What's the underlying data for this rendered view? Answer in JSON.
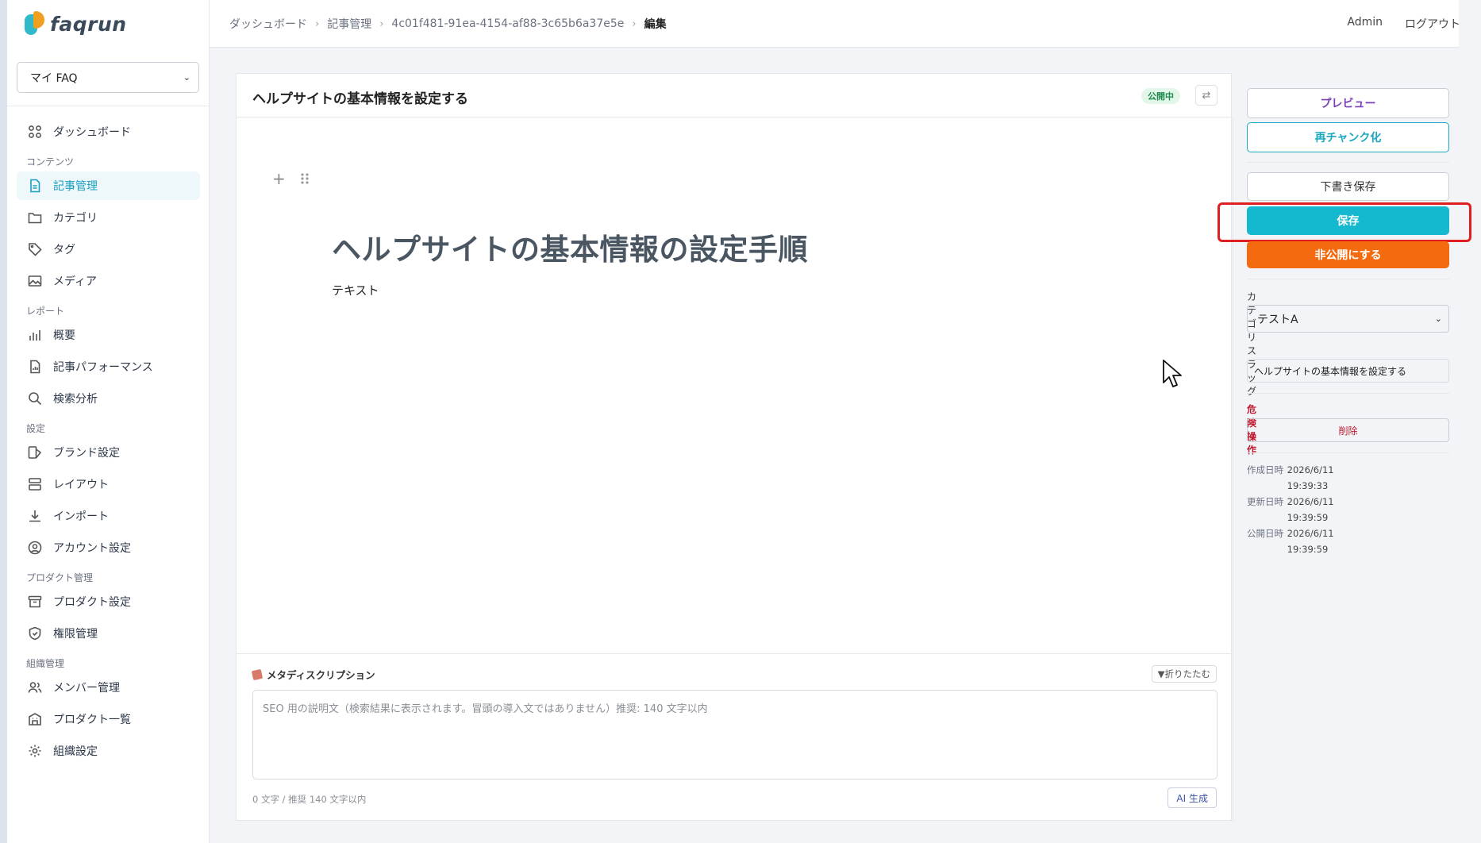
{
  "app": {
    "logo_text": "faqrun"
  },
  "sidebar": {
    "workspace": "マイ FAQ",
    "items": [
      {
        "type": "item",
        "label": "ダッシュボード",
        "icon": "dashboard-icon",
        "active": false
      },
      {
        "type": "group",
        "label": "コンテンツ"
      },
      {
        "type": "item",
        "label": "記事管理",
        "icon": "document-icon",
        "active": true
      },
      {
        "type": "item",
        "label": "カテゴリ",
        "icon": "folder-icon",
        "active": false
      },
      {
        "type": "item",
        "label": "タグ",
        "icon": "tag-icon",
        "active": false
      },
      {
        "type": "item",
        "label": "メディア",
        "icon": "image-icon",
        "active": false
      },
      {
        "type": "group",
        "label": "レポート"
      },
      {
        "type": "item",
        "label": "概要",
        "icon": "bar-chart-icon",
        "active": false
      },
      {
        "type": "item",
        "label": "記事パフォーマンス",
        "icon": "document-chart-icon",
        "active": false
      },
      {
        "type": "item",
        "label": "検索分析",
        "icon": "search-icon",
        "active": false
      },
      {
        "type": "group",
        "label": "設定"
      },
      {
        "type": "item",
        "label": "ブランド設定",
        "icon": "brand-icon",
        "active": false
      },
      {
        "type": "item",
        "label": "レイアウト",
        "icon": "layout-icon",
        "active": false
      },
      {
        "type": "item",
        "label": "インポート",
        "icon": "download-icon",
        "active": false
      },
      {
        "type": "item",
        "label": "アカウント設定",
        "icon": "user-circle-icon",
        "active": false
      },
      {
        "type": "group",
        "label": "プロダクト管理"
      },
      {
        "type": "item",
        "label": "プロダクト設定",
        "icon": "box-icon",
        "active": false
      },
      {
        "type": "item",
        "label": "権限管理",
        "icon": "shield-icon",
        "active": false
      },
      {
        "type": "group",
        "label": "組織管理"
      },
      {
        "type": "item",
        "label": "メンバー管理",
        "icon": "users-icon",
        "active": false
      },
      {
        "type": "item",
        "label": "プロダクト一覧",
        "icon": "building-icon",
        "active": false
      },
      {
        "type": "item",
        "label": "組織設定",
        "icon": "gear-icon",
        "active": false
      }
    ]
  },
  "header": {
    "breadcrumb": [
      "ダッシュボード",
      "記事管理",
      "4c01f481-91ea-4154-af88-3c65b6a37e5e",
      "編集"
    ],
    "user": "Admin",
    "logout": "ログアウト"
  },
  "article": {
    "title": "ヘルプサイトの基本情報を設定する",
    "status": "公開中",
    "heading": "ヘルプサイトの基本情報の設定手順",
    "body": "テキスト"
  },
  "meta": {
    "title": "メタディスクリプション",
    "collapse": "▼折りたたむ",
    "placeholder": "SEO 用の説明文（検索結果に表示されます。冒頭の導入文ではありません）推奨: 140 文字以内",
    "count": "0 文字 / 推奨 140 文字以内",
    "ai_button": "AI 生成"
  },
  "panel": {
    "preview": "プレビュー",
    "rechunk": "再チャンク化",
    "draft_save": "下書き保存",
    "save": "保存",
    "unpublish": "非公開にする",
    "category_label": "カテゴリ",
    "category_value": "テストA",
    "slug_label": "スラッグ",
    "slug_value": "ヘルプサイトの基本情報を設定する",
    "danger_label": "危険操作",
    "delete": "削除",
    "dates": [
      {
        "label": "作成日時",
        "value": "2026/6/11 19:39:33"
      },
      {
        "label": "更新日時",
        "value": "2026/6/11 19:39:59"
      },
      {
        "label": "公開日時",
        "value": "2026/6/11 19:39:59"
      }
    ]
  },
  "colors": {
    "accent": "#15b9cf",
    "warning": "#f46a0f",
    "danger": "#c0182c",
    "published": "#1e8a4c"
  }
}
